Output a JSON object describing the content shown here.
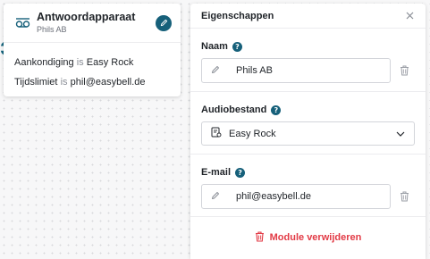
{
  "node": {
    "title": "Antwoordapparaat",
    "subtitle": "Phils AB",
    "lines": [
      {
        "key": "Aankondiging",
        "sep": "is",
        "value": "Easy Rock"
      },
      {
        "key": "Tijdslimiet",
        "sep": "is",
        "value": "phil@easybell.de"
      }
    ],
    "icon": "voicemail-icon"
  },
  "panel": {
    "title": "Eigenschappen",
    "name_field": {
      "label": "Naam",
      "value": "Phils AB"
    },
    "audio_field": {
      "label": "Audiobestand",
      "value": "Easy Rock"
    },
    "email_field": {
      "label": "E-mail",
      "value": "phil@easybell.de"
    },
    "remove_label": "Module verwijderen"
  },
  "colors": {
    "accent": "#16607a",
    "danger": "#e23a45"
  }
}
